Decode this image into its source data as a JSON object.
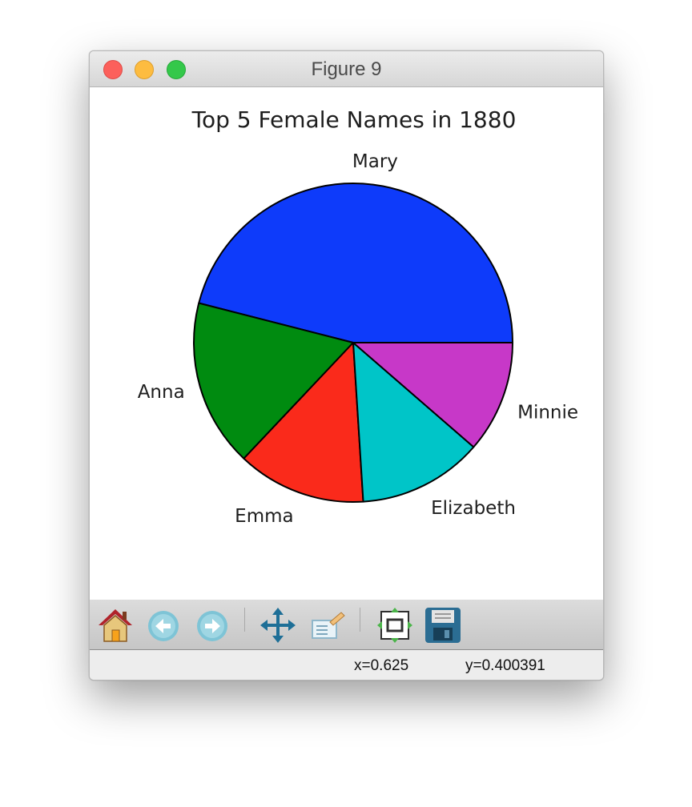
{
  "window": {
    "title": "Figure 9"
  },
  "chart_data": {
    "type": "pie",
    "title": "Top 5 Female Names in 1880",
    "labels": [
      "Mary",
      "Anna",
      "Emma",
      "Elizabeth",
      "Minnie"
    ],
    "values": [
      7065,
      2604,
      2003,
      1939,
      1746
    ],
    "colors": [
      "#0e3bfa",
      "#008b10",
      "#fa2a1b",
      "#00c5c8",
      "#c738c8"
    ],
    "start_angle": 0,
    "counterclock": true,
    "edge_color": "#000000"
  },
  "toolbar": {
    "buttons": [
      {
        "name": "home-icon"
      },
      {
        "name": "back-icon"
      },
      {
        "name": "forward-icon"
      },
      {
        "name": "pan-icon"
      },
      {
        "name": "zoom-icon"
      },
      {
        "name": "configure-subplots-icon"
      },
      {
        "name": "save-icon"
      }
    ]
  },
  "status": {
    "x_readout": "x=0.625",
    "y_readout": "y=0.400391"
  }
}
